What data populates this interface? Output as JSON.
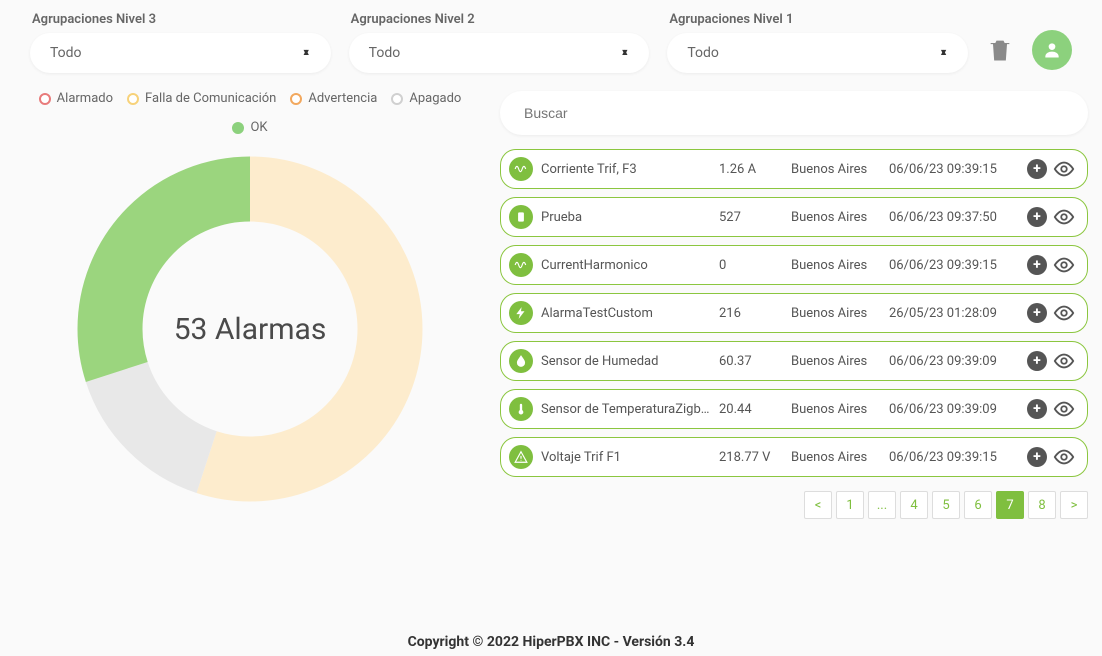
{
  "filters": {
    "level3": {
      "label": "Agrupaciones Nivel 3",
      "value": "Todo"
    },
    "level2": {
      "label": "Agrupaciones Nivel 2",
      "value": "Todo"
    },
    "level1": {
      "label": "Agrupaciones Nivel 1",
      "value": "Todo"
    }
  },
  "legend": [
    {
      "label": "Alarmado",
      "color": "#e87b7b"
    },
    {
      "label": "Falla de Comunicación",
      "color": "#f7d27a"
    },
    {
      "label": "Advertencia",
      "color": "#f2a85e"
    },
    {
      "label": "Apagado",
      "color": "#d0d0d0"
    },
    {
      "label": "OK",
      "color": "#8cd17d"
    }
  ],
  "chart_data": {
    "type": "pie",
    "title": "53 Alarmas",
    "series": [
      {
        "name": "Falla de Comunicación",
        "value": 55,
        "color": "#fdeccd"
      },
      {
        "name": "Apagado",
        "value": 15,
        "color": "#e8e8e8"
      },
      {
        "name": "OK",
        "value": 30,
        "color": "#9bd57e"
      }
    ],
    "center_label": "53 Alarmas"
  },
  "search": {
    "placeholder": "Buscar"
  },
  "alarms": [
    {
      "icon": "wave",
      "name": "Corriente Trif, F3",
      "value": "1.26 A",
      "location": "Buenos Aires",
      "time": "06/06/23 09:39:15"
    },
    {
      "icon": "device",
      "name": "Prueba",
      "value": "527",
      "location": "Buenos Aires",
      "time": "06/06/23 09:37:50"
    },
    {
      "icon": "wave",
      "name": "CurrentHarmonico",
      "value": "0",
      "location": "Buenos Aires",
      "time": "06/06/23 09:39:15"
    },
    {
      "icon": "bolt",
      "name": "AlarmaTestCustom",
      "value": "216",
      "location": "Buenos Aires",
      "time": "26/05/23 01:28:09"
    },
    {
      "icon": "drop",
      "name": "Sensor de Humedad",
      "value": "60.37",
      "location": "Buenos Aires",
      "time": "06/06/23 09:39:09"
    },
    {
      "icon": "thermo",
      "name": "Sensor de TemperaturaZigbee",
      "value": "20.44",
      "location": "Buenos Aires",
      "time": "06/06/23 09:39:09"
    },
    {
      "icon": "warn",
      "name": "Voltaje Trif F1",
      "value": "218.77 V",
      "location": "Buenos Aires",
      "time": "06/06/23 09:39:15"
    }
  ],
  "pagination": {
    "prev": "<",
    "next": ">",
    "pages": [
      "1",
      "...",
      "4",
      "5",
      "6",
      "7",
      "8"
    ],
    "active": "7"
  },
  "footer": "Copyright © 2022 HiperPBX INC - Versión 3.4"
}
